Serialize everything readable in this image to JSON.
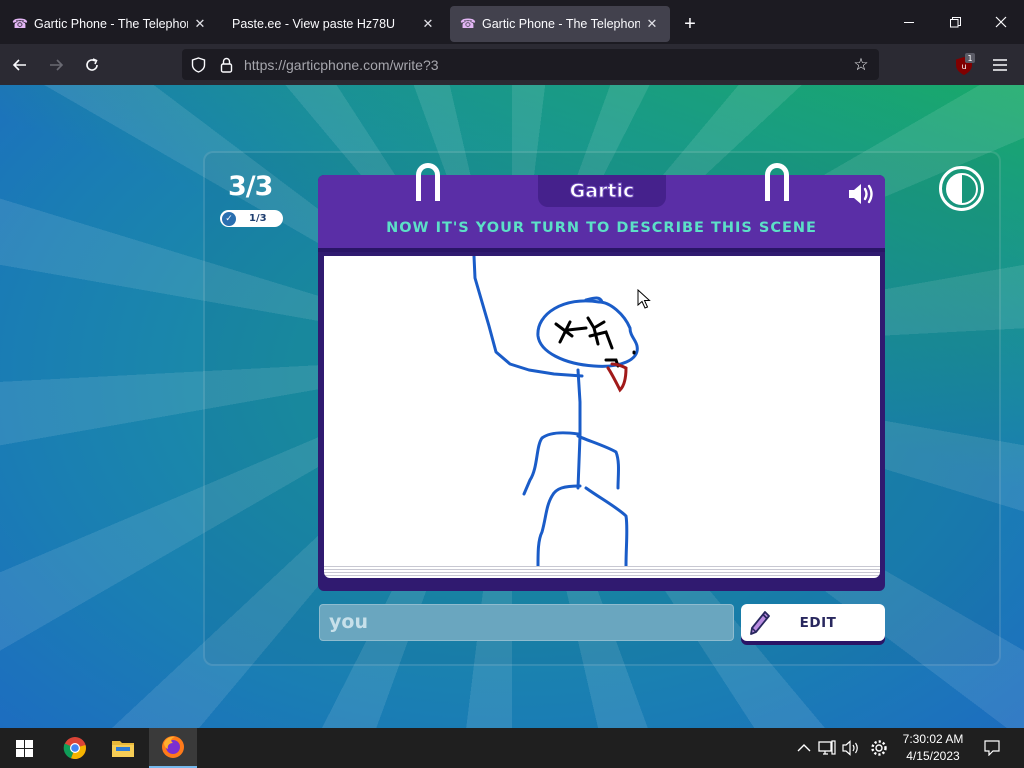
{
  "browser": {
    "tabs": [
      {
        "title": "Gartic Phone - The Telephone G",
        "active": false
      },
      {
        "title": "Paste.ee - View paste Hz78U",
        "active": false
      },
      {
        "title": "Gartic Phone - The Telephone G",
        "active": true
      }
    ],
    "url": "https://garticphone.com/write?3",
    "extension_badge": "1"
  },
  "game": {
    "logo": "Gartic",
    "round": "3/3",
    "progress": "1/3",
    "instruction": "NOW IT'S YOUR TURN TO DESCRIBE THIS SCENE",
    "answer_value": "you",
    "edit_label": "EDIT"
  },
  "taskbar": {
    "time": "7:30:02 AM",
    "date": "4/15/2023"
  },
  "colors": {
    "header_purple": "#5a2ea6",
    "instruction_teal": "#5ce0c7",
    "drawing_blue": "#1a5cc8",
    "drawing_red": "#a11a1a"
  }
}
